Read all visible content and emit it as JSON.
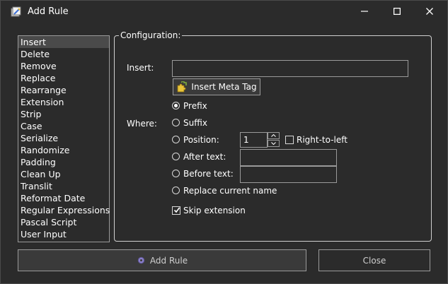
{
  "window": {
    "title": "Add Rule",
    "minimize": "—",
    "maximize": "☐",
    "close": "✕"
  },
  "rules": [
    {
      "label": "Insert",
      "selected": true
    },
    {
      "label": "Delete"
    },
    {
      "label": "Remove"
    },
    {
      "label": "Replace"
    },
    {
      "label": "Rearrange"
    },
    {
      "label": "Extension"
    },
    {
      "label": "Strip"
    },
    {
      "label": "Case"
    },
    {
      "label": "Serialize"
    },
    {
      "label": "Randomize"
    },
    {
      "label": "Padding"
    },
    {
      "label": "Clean Up"
    },
    {
      "label": "Translit"
    },
    {
      "label": "Reformat Date"
    },
    {
      "label": "Regular Expressions"
    },
    {
      "label": "Pascal Script"
    },
    {
      "label": "User Input"
    }
  ],
  "config": {
    "legend": "Configuration:",
    "insert_label": "Insert:",
    "insert_value": "",
    "meta_tag_button": "Insert Meta Tag",
    "where_label": "Where:",
    "options": {
      "prefix": "Prefix",
      "suffix": "Suffix",
      "position": "Position:",
      "after_text": "After text:",
      "before_text": "Before text:",
      "replace_name": "Replace current name"
    },
    "selected_option": "prefix",
    "position_value": "1",
    "right_to_left": "Right-to-left",
    "right_to_left_checked": false,
    "after_text_value": "",
    "before_text_value": "",
    "skip_extension": "Skip extension",
    "skip_extension_checked": true
  },
  "buttons": {
    "add_rule": "Add Rule",
    "close": "Close"
  }
}
